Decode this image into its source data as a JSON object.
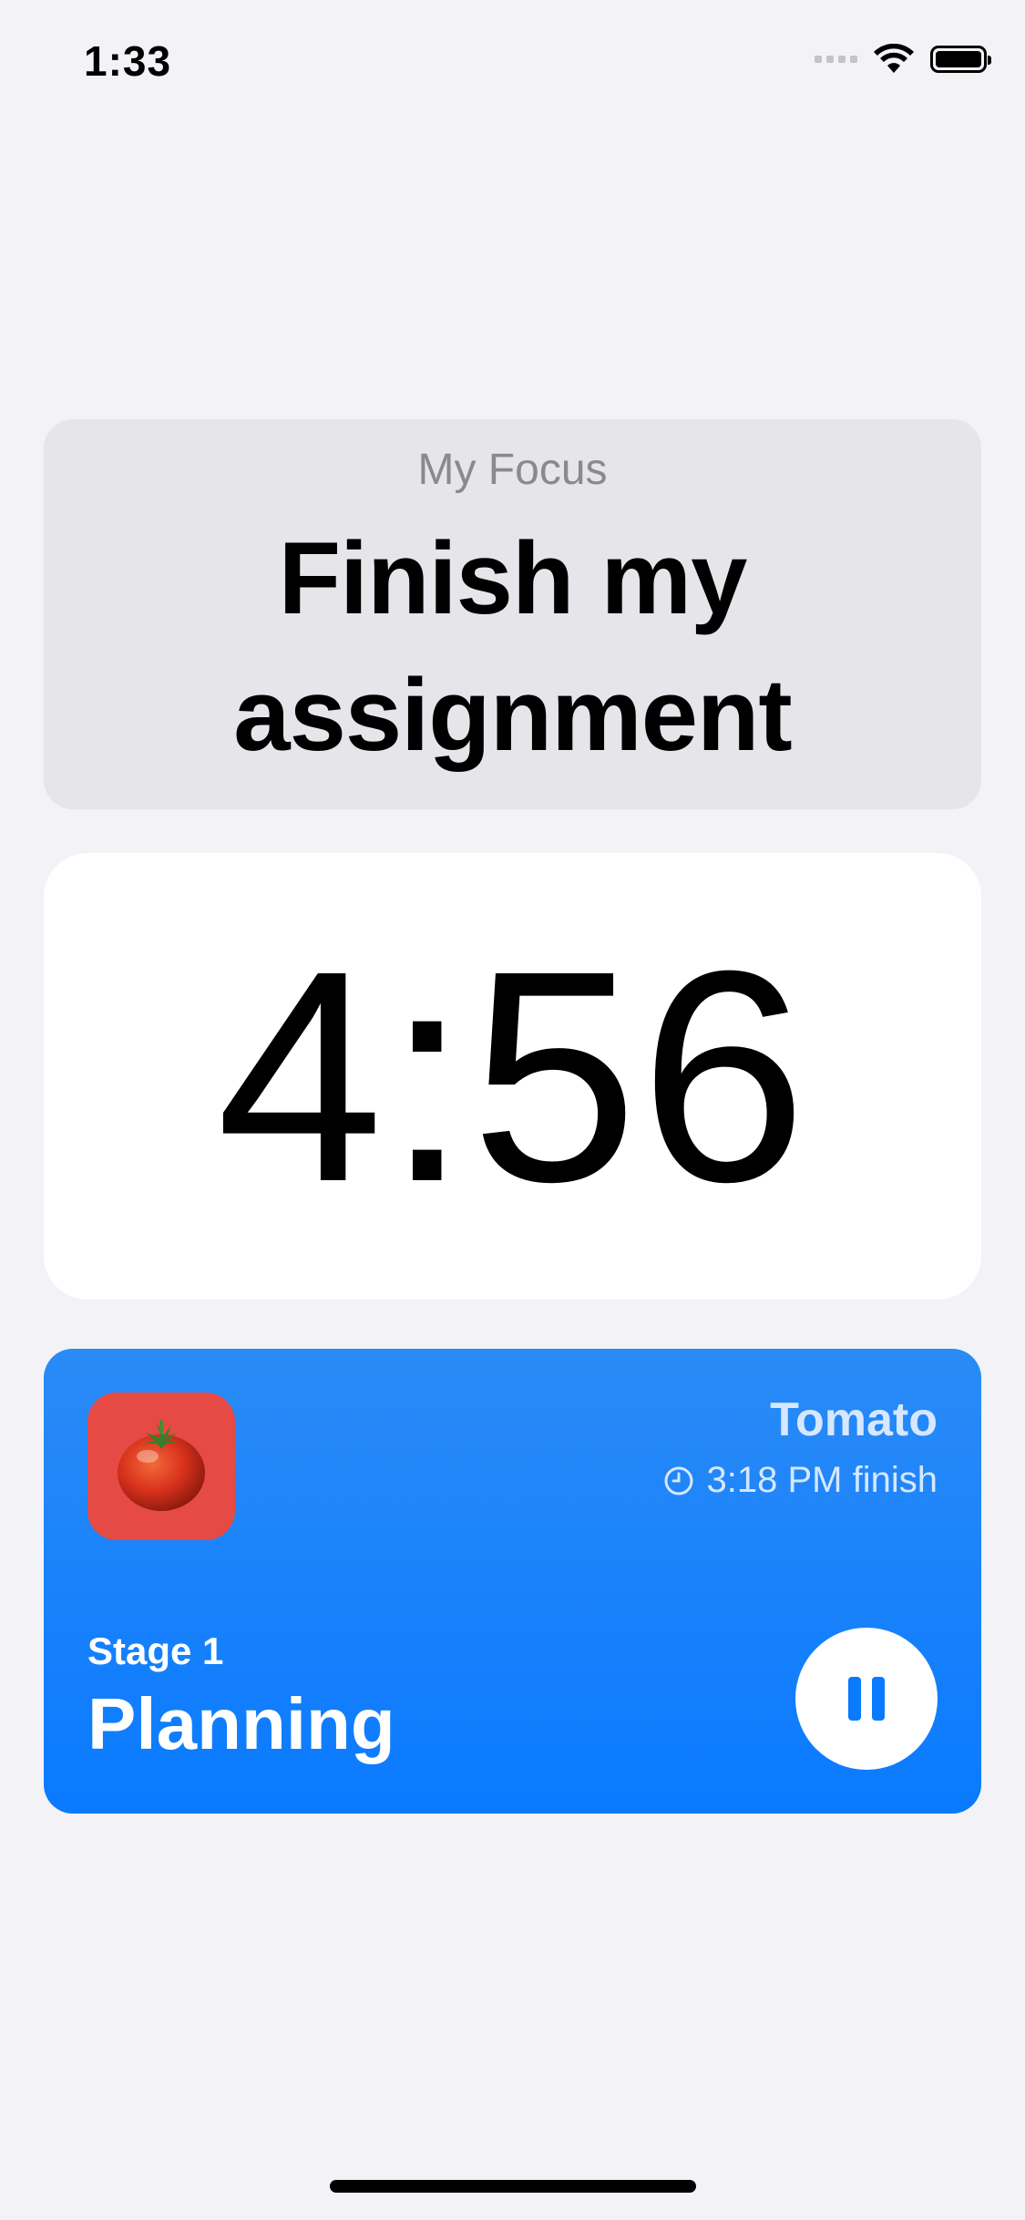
{
  "status_bar": {
    "time": "1:33"
  },
  "focus": {
    "label": "My Focus",
    "title": "Finish my assignment"
  },
  "timer": {
    "remaining": "4:56"
  },
  "session": {
    "preset_name": "Tomato",
    "finish_time": "3:18 PM finish",
    "stage_number": "Stage 1",
    "stage_name": "Planning",
    "icon": "tomato-icon",
    "control_icon": "pause-icon"
  },
  "colors": {
    "background": "#f2f2f7",
    "card_gray": "#e5e5ea",
    "accent_blue": "#0a7aff",
    "app_icon_red": "#e54a45"
  }
}
